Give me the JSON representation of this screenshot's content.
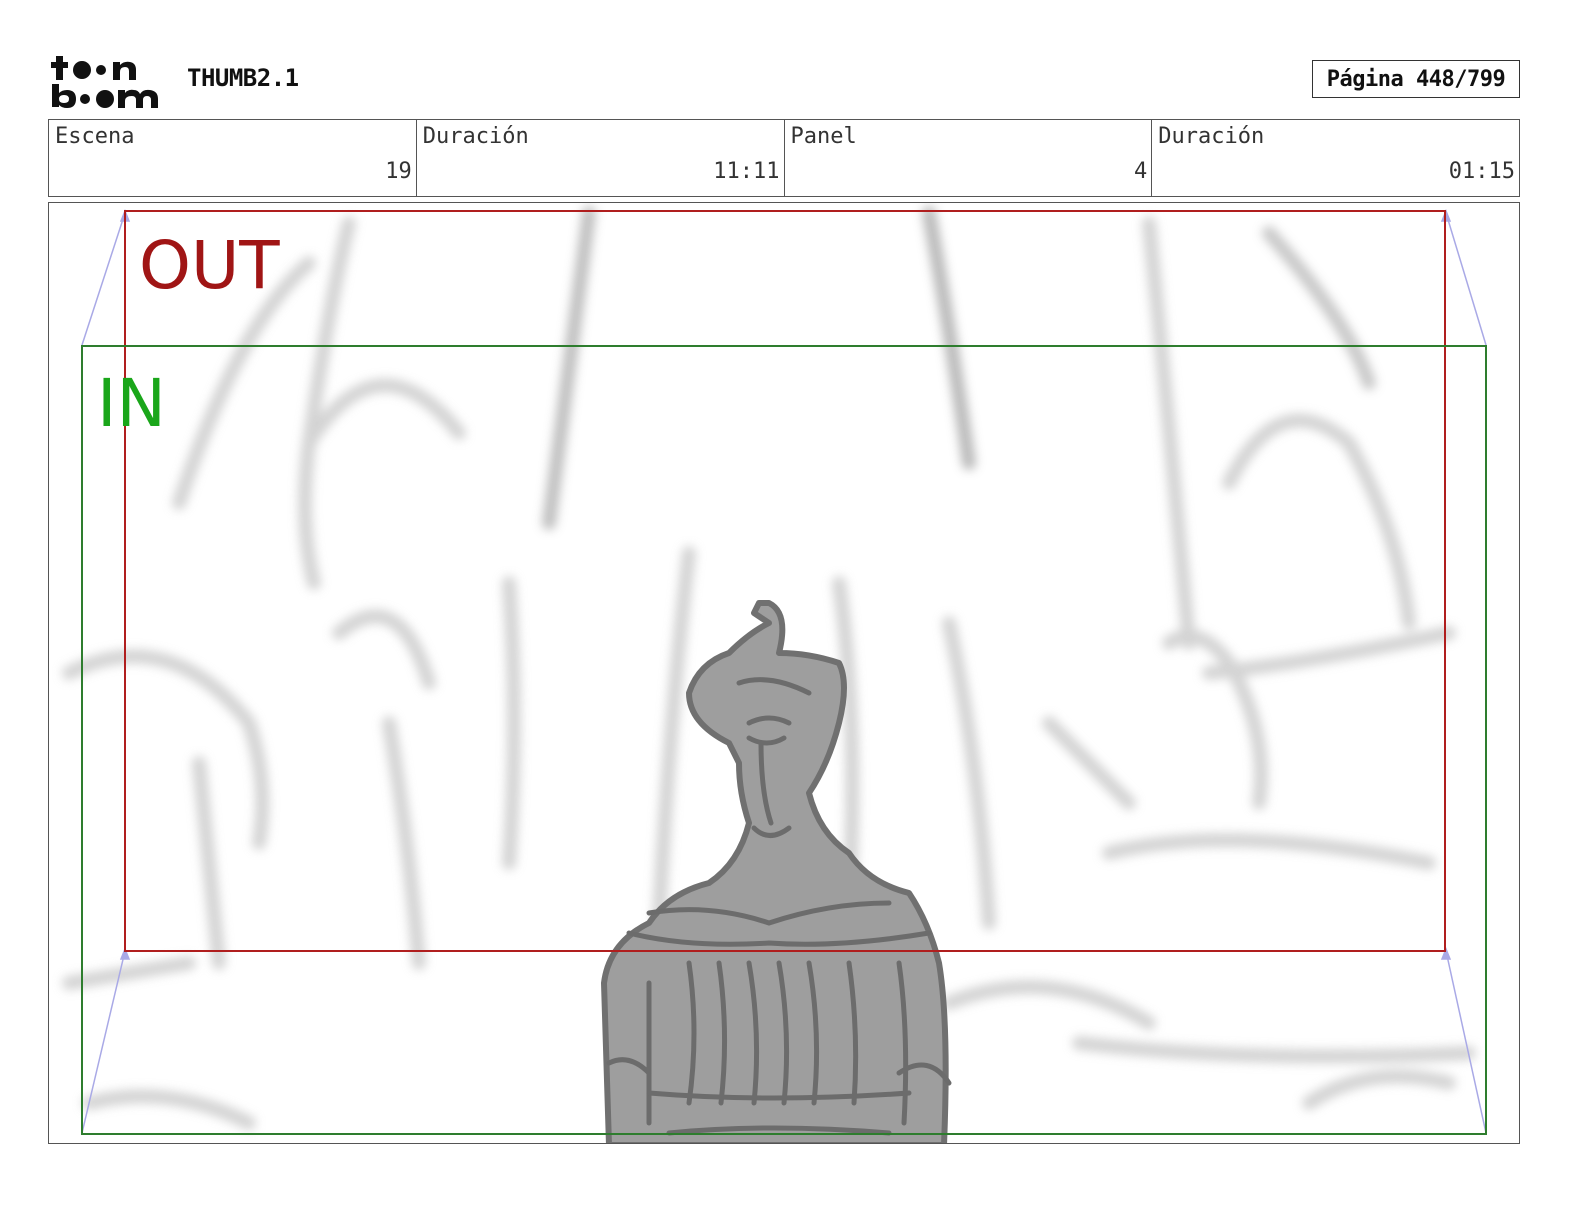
{
  "header": {
    "logo_text": "toon boom",
    "document_title": "THUMB2.1",
    "page_indicator": "Página 448/799"
  },
  "info": {
    "scene_label": "Escena",
    "scene_value": "19",
    "scene_duration_label": "Duración",
    "scene_duration_value": "11:11",
    "panel_label": "Panel",
    "panel_value": "4",
    "panel_duration_label": "Duración",
    "panel_duration_value": "01:15"
  },
  "panel": {
    "camera_out_label": "OUT",
    "camera_in_label": "IN",
    "colors": {
      "out_frame": "#b01e1e",
      "in_frame": "#2e7d2e",
      "in_label": "#1aa61a",
      "move_arrows": "#a9a9e6",
      "sketch": "#8a8a8a",
      "background_sketch": "#d2d2d2"
    }
  }
}
